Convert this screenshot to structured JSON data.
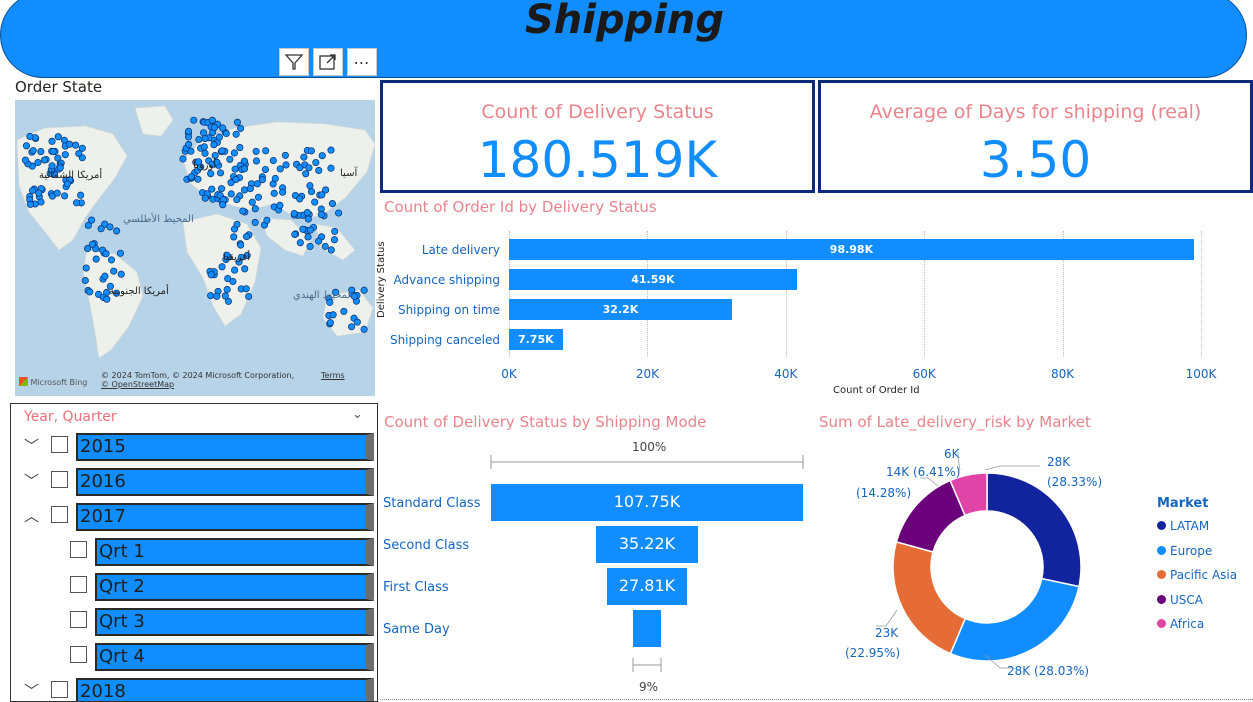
{
  "header": {
    "title": "Shipping",
    "accent": "#118dff"
  },
  "toolbar": {
    "filter_icon": "filter-icon",
    "focus_icon": "focus-mode-icon",
    "more_icon": "more-options-icon",
    "more_glyph": "⋯"
  },
  "map": {
    "title": "Order State",
    "labels": {
      "north_america": "أمريكا الشمالية",
      "europe": "أوروبا",
      "asia": "آسيا",
      "africa": "أفريقيا",
      "south_america": "أمريكا الجنوبية",
      "atlantic": "المحيط الأطلسي",
      "indian": "المحيط الهندي"
    },
    "copyright": "© 2024 TomTom, © 2024 Microsoft Corporation,",
    "osm": "© OpenStreetMap",
    "terms": "Terms",
    "bing": "Microsoft Bing",
    "point_color": "#118dff"
  },
  "slicer": {
    "title": "Year, Quarter",
    "items": [
      {
        "label": "2015",
        "expanded": false,
        "level": 0
      },
      {
        "label": "2016",
        "expanded": false,
        "level": 0
      },
      {
        "label": "2017",
        "expanded": true,
        "level": 0
      },
      {
        "label": "Qrt 1",
        "level": 1
      },
      {
        "label": "Qrt 2",
        "level": 1
      },
      {
        "label": "Qrt 3",
        "level": 1
      },
      {
        "label": "Qrt 4",
        "level": 1
      },
      {
        "label": "2018",
        "expanded": false,
        "level": 0
      }
    ]
  },
  "cards": [
    {
      "label": "Count of Delivery Status",
      "value": "180.519K"
    },
    {
      "label": "Average of Days for shipping (real)",
      "value": "3.50"
    }
  ],
  "bar_chart": {
    "title": "Count of Order Id by Delivery Status",
    "ylabel": "Delivery Status",
    "xlabel": "Count of Order Id",
    "ticks": [
      "0K",
      "20K",
      "40K",
      "60K",
      "80K",
      "100K"
    ]
  },
  "funnel": {
    "title": "Count of Delivery Status by Shipping Mode",
    "top_pct": "100%",
    "bottom_pct": "9%"
  },
  "donut": {
    "title": "Sum of Late_delivery_risk by Market",
    "legend_title": "Market",
    "data_labels": [
      {
        "key": "latam",
        "l1": "28K",
        "l2": "(28.33%)"
      },
      {
        "key": "europe",
        "l1": "28K (28.03%)",
        "l2": ""
      },
      {
        "key": "pacific",
        "l1": "23K",
        "l2": "(22.95%)"
      },
      {
        "key": "usca",
        "l1": "14K (6.41%)",
        "l2": "(14.28%)"
      },
      {
        "key": "africa",
        "l1": "6K",
        "l2": ""
      }
    ]
  },
  "chart_data": [
    {
      "type": "bar",
      "title": "Count of Order Id by Delivery Status",
      "xlabel": "Count of Order Id",
      "ylabel": "Delivery Status",
      "categories": [
        "Late delivery",
        "Advance shipping",
        "Shipping on time",
        "Shipping canceled"
      ],
      "values": [
        98980,
        41590,
        32200,
        7750
      ],
      "value_labels": [
        "98.98K",
        "41.59K",
        "32.2K",
        "7.75K"
      ],
      "xlim": [
        0,
        100000
      ],
      "color": "#118dff"
    },
    {
      "type": "bar",
      "subtype": "funnel",
      "title": "Count of Delivery Status by Shipping Mode",
      "categories": [
        "Standard Class",
        "Second Class",
        "First Class",
        "Same Day"
      ],
      "values": [
        107750,
        35220,
        27810,
        9740
      ],
      "value_labels": [
        "107.75K",
        "35.22K",
        "27.81K",
        ""
      ],
      "color": "#118dff"
    },
    {
      "type": "pie",
      "subtype": "donut",
      "title": "Sum of Late_delivery_risk by Market",
      "categories": [
        "LATAM",
        "Europe",
        "Pacific Asia",
        "USCA",
        "Africa"
      ],
      "values": [
        28.33,
        28.03,
        22.95,
        14.28,
        6.41
      ],
      "colors": [
        "#12239e",
        "#118dff",
        "#e66c37",
        "#6b007b",
        "#e044a7"
      ],
      "legend": "right"
    }
  ]
}
